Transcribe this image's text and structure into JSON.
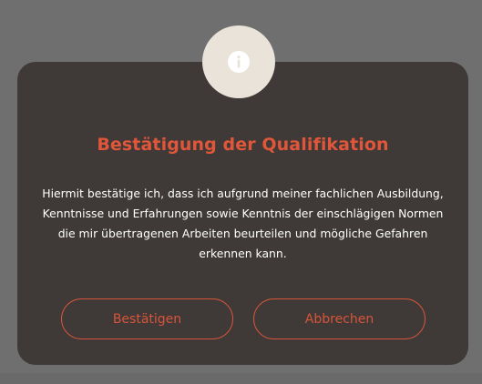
{
  "dialog": {
    "icon": "info-icon",
    "title": "Bestätigung der Qualifikation",
    "message": "Hiermit bestätige ich, dass ich aufgrund meiner fachlichen Ausbildung, Kenntnisse und Erfahrungen sowie Kenntnis der einschlägigen Normen die mir übertragenen Arbeiten beurteilen und mögliche Gefahren erkennen kann.",
    "confirm_label": "Bestätigen",
    "cancel_label": "Abbrechen"
  },
  "colors": {
    "overlay": "#6f6f6f",
    "dialog_background": "#3f3a37",
    "badge_background": "#e9e3da",
    "accent": "#e0563a",
    "text": "#ffffff"
  }
}
